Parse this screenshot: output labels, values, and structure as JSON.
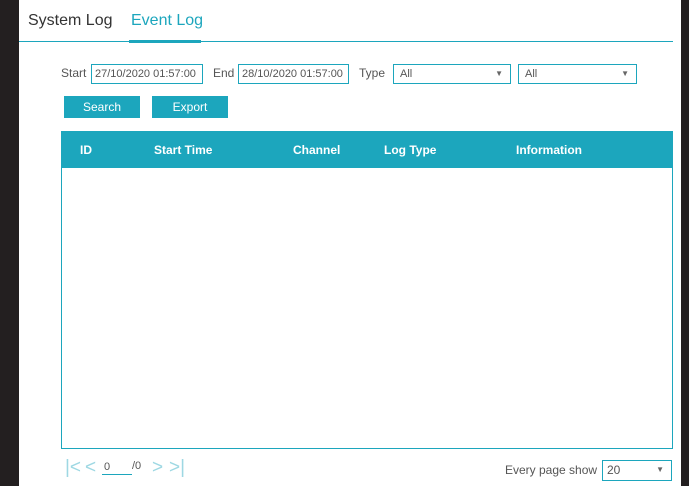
{
  "tabs": [
    {
      "label": "System Log"
    },
    {
      "label": "Event Log"
    }
  ],
  "filters": {
    "start_label": "Start",
    "start_value": "27/10/2020 01:57:00",
    "end_label": "End",
    "end_value": "28/10/2020 01:57:00",
    "type_label": "Type",
    "type_value": "All",
    "subtype_value": "All"
  },
  "buttons": {
    "search": "Search",
    "export": "Export"
  },
  "table": {
    "columns": [
      "ID",
      "Start Time",
      "Channel",
      "Log Type",
      "Information"
    ],
    "rows": []
  },
  "pagination": {
    "current_page": "0",
    "total": "/0",
    "per_page_label": "Every page show",
    "per_page_value": "20"
  },
  "colors": {
    "accent": "#1ca6bd",
    "frame": "#231f20"
  },
  "icons": [
    "first-page-icon",
    "prev-page-icon",
    "next-page-icon",
    "last-page-icon",
    "dropdown-caret-icon"
  ]
}
